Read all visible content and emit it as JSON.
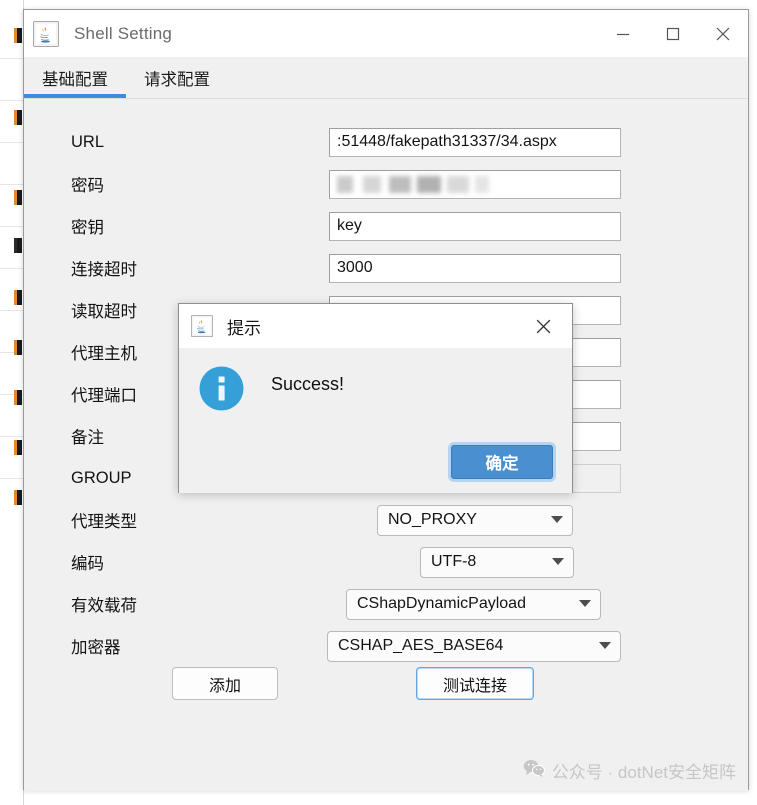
{
  "window": {
    "title": "Shell Setting",
    "app_icon": "java-icon",
    "controls": {
      "minimize": "minimize-icon",
      "maximize": "maximize-icon",
      "close": "close-icon"
    }
  },
  "tabs": [
    {
      "label": "基础配置",
      "active": true
    },
    {
      "label": "请求配置",
      "active": false
    }
  ],
  "form": {
    "rows": [
      {
        "label": "URL",
        "kind": "text",
        "value": ":51448/fakepath31337/34.aspx"
      },
      {
        "label": "密码",
        "kind": "password",
        "value": ""
      },
      {
        "label": "密钥",
        "kind": "text",
        "value": "key"
      },
      {
        "label": "连接超时",
        "kind": "text",
        "value": "3000"
      },
      {
        "label": "读取超时",
        "kind": "text",
        "value": ""
      },
      {
        "label": "代理主机",
        "kind": "text",
        "value": ""
      },
      {
        "label": "代理端口",
        "kind": "text",
        "value": ""
      },
      {
        "label": "备注",
        "kind": "text",
        "value": ""
      },
      {
        "label": "GROUP",
        "kind": "text",
        "value": "/",
        "disabled": true
      },
      {
        "label": "代理类型",
        "kind": "combo",
        "value": "NO_PROXY"
      },
      {
        "label": "编码",
        "kind": "combo",
        "value": "UTF-8"
      },
      {
        "label": "有效载荷",
        "kind": "combo",
        "value": "CShapDynamicPayload"
      },
      {
        "label": "加密器",
        "kind": "combo",
        "value": "CSHAP_AES_BASE64"
      }
    ]
  },
  "buttons": {
    "add": "添加",
    "test_connection": "测试连接"
  },
  "watermark": {
    "icon": "wechat-icon",
    "text": "公众号 · dotNet安全矩阵"
  },
  "dialog": {
    "icon": "java-icon",
    "title": "提示",
    "close": "close-icon",
    "status_icon": "info-icon",
    "message": "Success!",
    "ok_label": "确定"
  },
  "colors": {
    "accent": "#3e8ddd",
    "dialog_button": "#4a8fd0",
    "info_icon": "#35a0d8",
    "window_bg": "#f0f0f0",
    "watermark": "#c6c6c6"
  }
}
